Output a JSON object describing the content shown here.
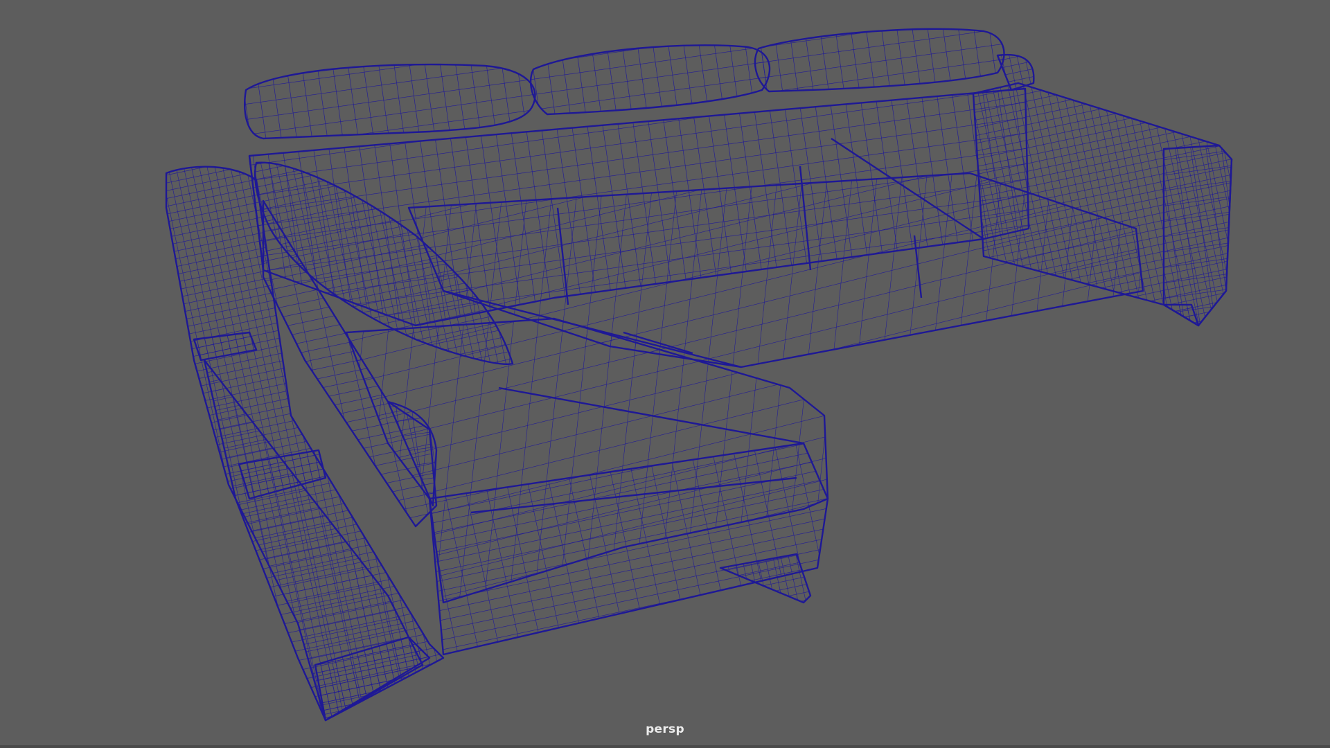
{
  "viewport": {
    "camera_name": "persp",
    "background_color": "#5d5d5d",
    "wireframe_color": "#1e1896",
    "model": "sectional-sofa-wireframe"
  }
}
